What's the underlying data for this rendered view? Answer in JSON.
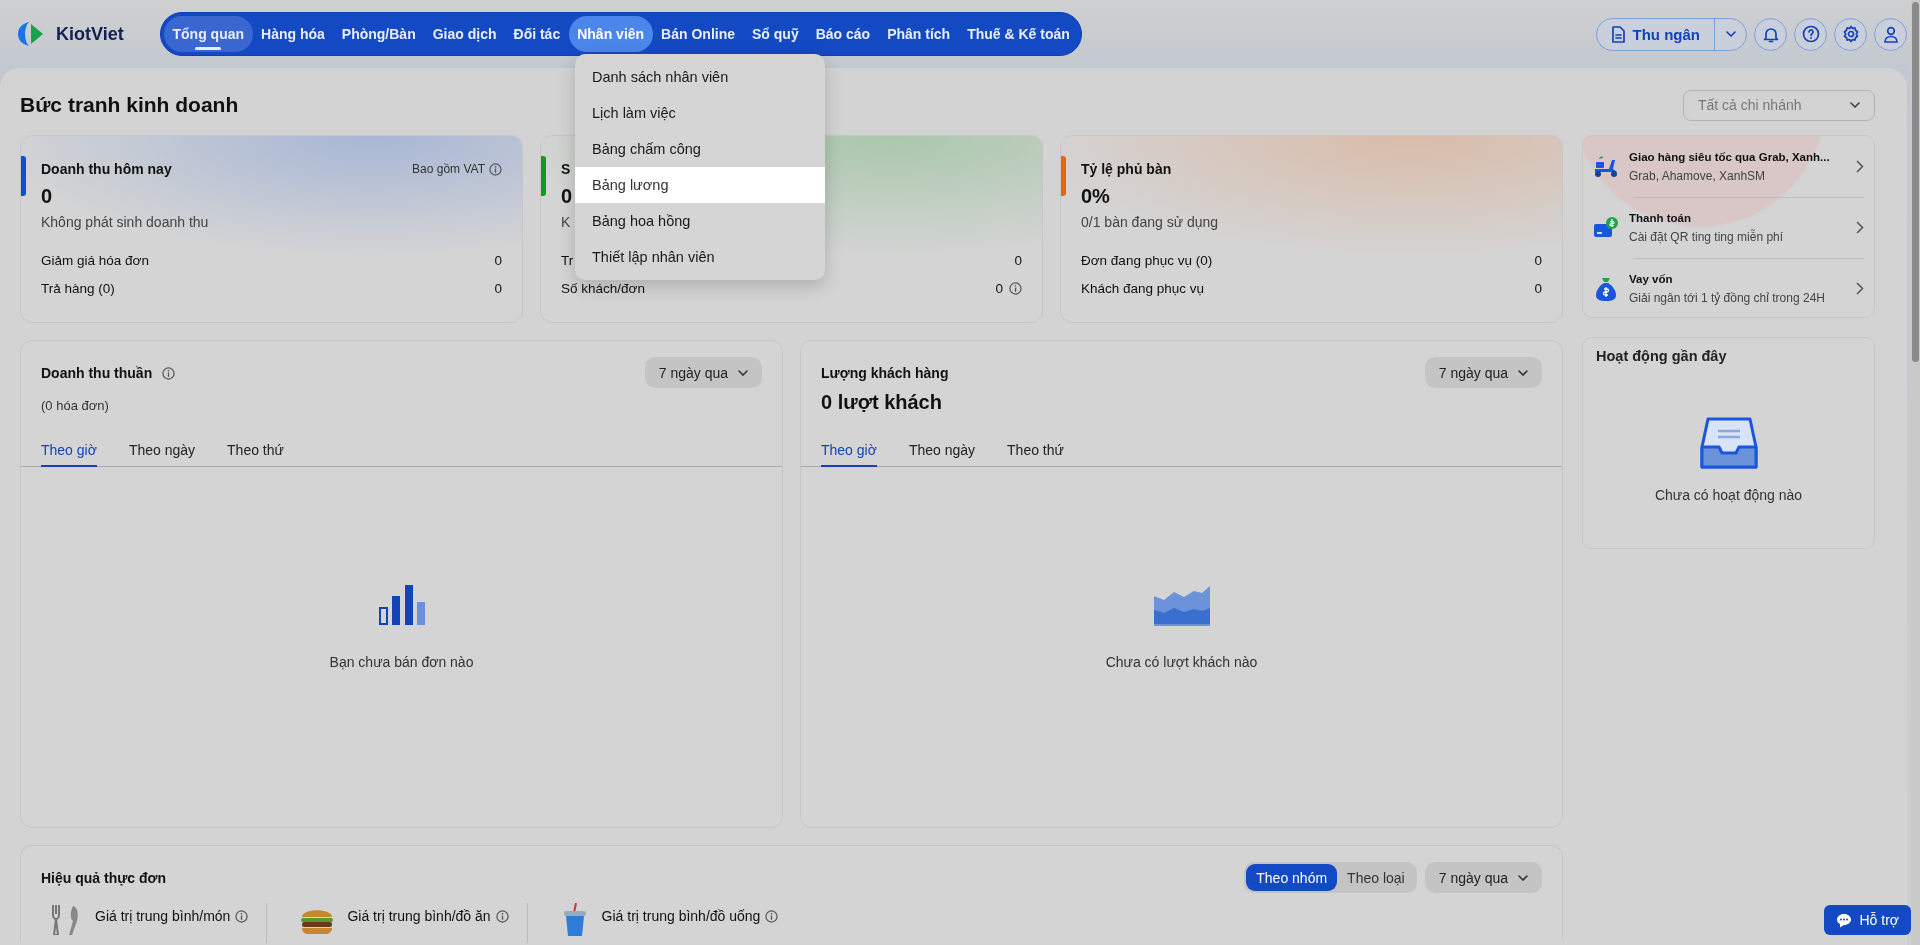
{
  "brand": {
    "name": "KiotViet"
  },
  "nav": [
    {
      "label": "Tổng quan",
      "selected": true,
      "expanded": false
    },
    {
      "label": "Hàng hóa",
      "selected": false,
      "expanded": false
    },
    {
      "label": "Phòng/Bàn",
      "selected": false,
      "expanded": false
    },
    {
      "label": "Giao dịch",
      "selected": false,
      "expanded": false
    },
    {
      "label": "Đối tác",
      "selected": false,
      "expanded": false
    },
    {
      "label": "Nhân viên",
      "selected": false,
      "expanded": true
    },
    {
      "label": "Bán Online",
      "selected": false,
      "expanded": false
    },
    {
      "label": "Sổ quỹ",
      "selected": false,
      "expanded": false
    },
    {
      "label": "Báo cáo",
      "selected": false,
      "expanded": false
    },
    {
      "label": "Phân tích",
      "selected": false,
      "expanded": false
    },
    {
      "label": "Thuế & Kế toán",
      "selected": false,
      "expanded": false
    }
  ],
  "nav_menu": [
    {
      "label": "Danh sách nhân viên",
      "selected": false
    },
    {
      "label": "Lịch làm việc",
      "selected": false
    },
    {
      "label": "Bảng chấm công",
      "selected": false
    },
    {
      "label": "Bảng lương",
      "selected": true
    },
    {
      "label": "Bảng hoa hồng",
      "selected": false
    },
    {
      "label": "Thiết lập nhân viên",
      "selected": false
    }
  ],
  "toolbar": {
    "cashier": "Thu ngân"
  },
  "page": {
    "title": "Bức tranh kinh doanh",
    "branch_select": "Tất cả chi nhánh"
  },
  "stat_cards": [
    {
      "title": "Doanh thu hôm nay",
      "note": "Bao gồm VAT",
      "value": "0",
      "subtitle": "Không phát sinh doanh thu",
      "color": "#0a4fd6",
      "rows": [
        {
          "label": "Giảm giá hóa đơn",
          "value": "0",
          "info": false
        },
        {
          "label": "Trả hàng (0)",
          "value": "0",
          "info": false
        }
      ]
    },
    {
      "title": "S",
      "value": "0",
      "subtitle": "K",
      "color": "#119a1a",
      "rows": [
        {
          "label": "Tr",
          "value": "0",
          "info": false
        },
        {
          "label": "Số khách/đơn",
          "value": "0",
          "info": true
        }
      ]
    },
    {
      "title": "Tỷ lệ phủ bàn",
      "value": "0%",
      "subtitle": "0/1 bàn đang sử dụng",
      "color": "#e8650f",
      "rows": [
        {
          "label": "Đơn đang phục vụ (0)",
          "value": "0",
          "info": false
        },
        {
          "label": "Khách đang phục vụ",
          "value": "0",
          "info": false
        }
      ]
    }
  ],
  "chart_cards": [
    {
      "title": "Doanh thu thuần",
      "info": true,
      "summary": {
        "kind": "note",
        "text": "(0 hóa đơn)"
      },
      "period": "7 ngày qua",
      "tabs": [
        {
          "label": "Theo giờ",
          "selected": true
        },
        {
          "label": "Theo ngày",
          "selected": false
        },
        {
          "label": "Theo thứ",
          "selected": false
        }
      ],
      "empty": {
        "kind": "bars",
        "text": "Bạn chưa bán đơn nào"
      }
    },
    {
      "title": "Lượng khách hàng",
      "info": false,
      "summary": {
        "kind": "value",
        "text": "0 lượt khách"
      },
      "period": "7 ngày qua",
      "tabs": [
        {
          "label": "Theo giờ",
          "selected": true
        },
        {
          "label": "Theo ngày",
          "selected": false
        },
        {
          "label": "Theo thứ",
          "selected": false
        }
      ],
      "empty": {
        "kind": "area",
        "text": "Chưa có lượt khách nào"
      }
    }
  ],
  "promos": [
    {
      "kind": "delivery",
      "title": "Giao hàng siêu tốc qua Grab, Xanh...",
      "subtitle": "Grab, Ahamove, XanhSM"
    },
    {
      "kind": "payment",
      "title": "Thanh toán",
      "subtitle": "Cài đặt QR ting ting miễn phí"
    },
    {
      "kind": "loan",
      "title": "Vay vốn",
      "subtitle": "Giải ngân tới 1 tỷ đồng chỉ trong 24H"
    }
  ],
  "activity": {
    "title": "Hoạt động gần đây",
    "empty": "Chưa có hoạt động nào"
  },
  "menu_performance": {
    "title": "Hiệu quả thực đơn",
    "segments": [
      {
        "label": "Theo nhóm",
        "selected": true
      },
      {
        "label": "Theo loại",
        "selected": false
      }
    ],
    "period": "7 ngày qua",
    "metrics": [
      {
        "kind": "dish",
        "label": "Giá trị trung bình/món"
      },
      {
        "kind": "food",
        "label": "Giá trị trung bình/đồ ăn"
      },
      {
        "kind": "drink",
        "label": "Giá trị trung bình/đồ uống"
      }
    ]
  },
  "help": {
    "label": "Hỗ trợ"
  }
}
